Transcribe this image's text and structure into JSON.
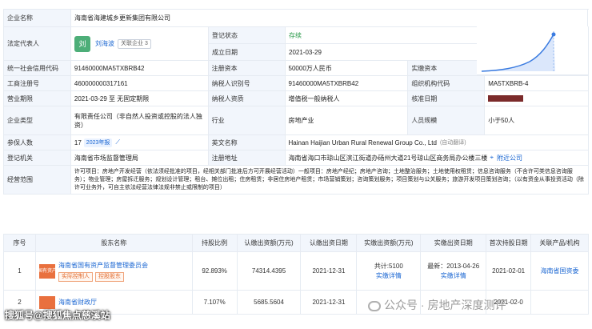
{
  "info": {
    "name_label": "企业名称",
    "name_value": "海南省海建城乡更新集团有限公司",
    "legal_label": "法定代表人",
    "legal_avatar": "刘",
    "legal_value": "刘海波",
    "legal_tag": "关联企业 3",
    "reg_status_label": "登记状态",
    "reg_status_value": "存续",
    "est_date_label": "成立日期",
    "est_date_value": "2021-03-29",
    "credit_label": "统一社会信用代码",
    "credit_value": "91460000MA5TXBRB42",
    "capital_label": "注册资本",
    "capital_value": "50000万人民币",
    "paid_label": "实缴资本",
    "paid_value": "-",
    "regno_label": "工商注册号",
    "regno_value": "460000000317161",
    "taxid_label": "纳税人识别号",
    "taxid_value": "91460000MA5TXBRB42",
    "orgcode_label": "组织机构代码",
    "orgcode_value": "MA5TXBRB-4",
    "term_label": "营业期限",
    "term_value": "2021-03-29 至 无固定期限",
    "taxpayer_label": "纳税人资质",
    "taxpayer_value": "增值税一般纳税人",
    "approve_label": "核准日期",
    "approve_value": "",
    "type_label": "企业类型",
    "type_value": "有限责任公司（非自然人投资或控股的法人独资）",
    "industry_label": "行业",
    "industry_value": "房地产业",
    "staff_label": "人员规模",
    "staff_value": "小于50人",
    "insured_label": "参保人数",
    "insured_value": "17",
    "insured_tag": "2023年报",
    "en_label": "英文名称",
    "en_value": "Hainan Haijian Urban Rural Renewal Group Co., Ltd",
    "en_note": "(自动翻译)",
    "authority_label": "登记机关",
    "authority_value": "海南省市场监督管理局",
    "address_label": "注册地址",
    "address_value": "海南省海口市琼山区滨江街道办砀州大道21号琼山区商务局办公楼三楼",
    "address_link": "附近公司",
    "scope_label": "经营范围",
    "scope_value": "许可项目：房地产开发经营（依法须经批准的项目，经相关部门批准后方可开展经营活动）一般项目：房地产经纪；房地产咨询；土地整治服务；土地使用权租赁；信息咨询服务（不含许可类信息咨询服务）；物业管理；房屋拆迁服务；规划设计管理；租台、摊位出租；住房租赁；非居住房地产租赁；市场营销策划；咨询策划服务；项目策划与公关服务；旅游开发项目策划咨询；（以有资金从事投资活动（除许可业务外，可自主依法经营法律法规非禁止或限制的项目）"
  },
  "shareholders": {
    "headers": [
      "序号",
      "股东名称",
      "持股比例",
      "认缴出资额(万元)",
      "认缴出资日期",
      "实缴出资额(万元)",
      "实缴出资日期",
      "首次持股日期",
      "关联产品/机构"
    ],
    "rows": [
      {
        "no": "1",
        "logo": "国有资产",
        "name": "海南省国有资产监督管理委员会",
        "tags": [
          "实际控制人",
          "控股股东"
        ],
        "ratio": "92.893%",
        "sub_amount": "74314.4395",
        "sub_date": "2021-12-31",
        "paid_amount": "共计:5100",
        "paid_link": "实缴详情",
        "paid_date": "最新：2013-04-26",
        "paid_date_link": "实缴详情",
        "first_date": "2021-02-01",
        "related": "海南省国资委"
      },
      {
        "no": "2",
        "name": "海南省财政厅",
        "ratio": "7.107%",
        "sub_amount": "5685.5604",
        "sub_date": "2021-12-31",
        "paid_amount": "",
        "paid_date": "",
        "first_date": "2021-02-0",
        "related": ""
      }
    ]
  },
  "overlay": {
    "footer": "搜狐号@搜狐焦点慈溪站",
    "watermark": "公众号 · 房地产深度测评"
  },
  "colors": {
    "link": "#1a66d2",
    "header_bg": "#f2f6fc",
    "accent_orange": "#e9703e"
  }
}
